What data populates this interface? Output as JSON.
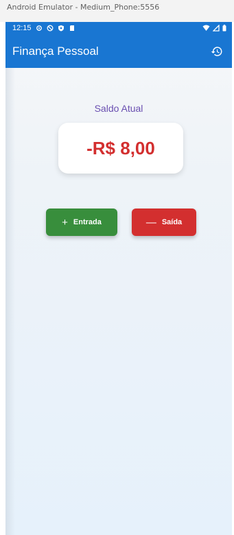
{
  "window": {
    "title": "Android Emulator - Medium_Phone:5556"
  },
  "status_bar": {
    "time": "12:15",
    "icons": [
      "settings-icon",
      "vpn-icon",
      "shield-icon",
      "sim-card-icon"
    ],
    "right_icons": [
      "wifi-icon",
      "signal-icon",
      "battery-icon"
    ]
  },
  "app_bar": {
    "title": "Finança Pessoal",
    "action_icon": "history-icon",
    "color": "#1976d2"
  },
  "balance": {
    "label": "Saldo Atual",
    "value": "-R$ 8,00",
    "value_color": "#d32f2f"
  },
  "actions": {
    "income_label": "Entrada",
    "income_icon": "plus-icon",
    "income_color": "#388e3c",
    "expense_label": "Saída",
    "expense_icon": "minus-icon",
    "expense_color": "#d32f2f"
  }
}
